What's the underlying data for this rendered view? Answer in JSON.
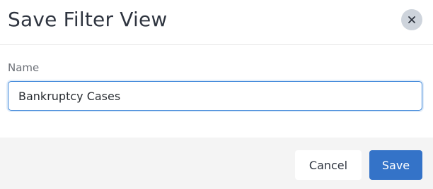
{
  "dialog": {
    "title": "Save Filter View",
    "close_icon": "close-icon"
  },
  "form": {
    "name_label": "Name",
    "name_value": "Bankruptcy Cases",
    "name_placeholder": ""
  },
  "footer": {
    "cancel_label": "Cancel",
    "save_label": "Save"
  },
  "colors": {
    "primary": "#3473c8",
    "focus_border": "#3d86d9",
    "close_bg": "#ced4dc",
    "footer_bg": "#f4f4f4"
  }
}
